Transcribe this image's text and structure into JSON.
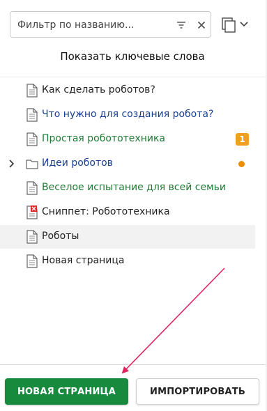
{
  "filter": {
    "placeholder": "Фильтр по названию..."
  },
  "keywords_toggle": "Показать ключевые слова",
  "tree": {
    "items": [
      {
        "label": "Как сделать роботов?",
        "icon": "document-icon",
        "color": "#222222"
      },
      {
        "label": "Что нужно для создания робота?",
        "icon": "document-icon",
        "color": "#1a3f8f"
      },
      {
        "label": "Простая робототехника",
        "icon": "document-icon",
        "color": "#1e7a34",
        "badge": "1"
      },
      {
        "label": "Идеи роботов",
        "icon": "folder-icon",
        "color": "#1a3f8f",
        "expandable": true,
        "status_dot": true
      },
      {
        "label": "Веселое испытание для всей семьи",
        "icon": "document-icon",
        "color": "#1e7a34"
      },
      {
        "label": "Сниппет: Робототехника",
        "icon": "document-error-icon",
        "color": "#222222"
      },
      {
        "label": "Роботы",
        "icon": "document-icon",
        "color": "#222222",
        "selected": true
      },
      {
        "label": "Новая страница",
        "icon": "document-icon",
        "color": "#222222"
      }
    ]
  },
  "actions": {
    "new_page": "НОВАЯ СТРАНИЦА",
    "import": "ИМПОРТИРОВАТЬ"
  },
  "colors": {
    "primary_green": "#178a3e",
    "badge_orange": "#f0a020",
    "dot_orange": "#f08c00",
    "annotation_arrow": "#e0245e"
  }
}
